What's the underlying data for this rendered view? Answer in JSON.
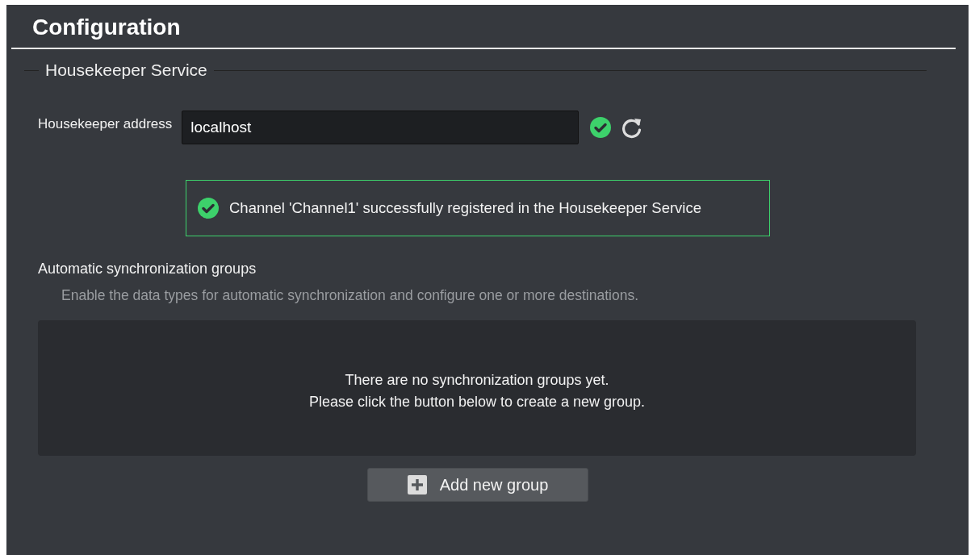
{
  "header": {
    "title": "Configuration"
  },
  "section": {
    "legend": "Housekeeper Service"
  },
  "address": {
    "label": "Housekeeper address",
    "value": "localhost",
    "valid": true
  },
  "status_message": {
    "kind": "success",
    "text": "Channel 'Channel1' successfully registered in the Housekeeper Service"
  },
  "sync_groups": {
    "title": "Automatic synchronization groups",
    "description": "Enable the data types for automatic synchronization and configure one or more destinations.",
    "empty_lines": [
      "There are no synchronization groups yet.",
      "Please click the button below to create a new group."
    ],
    "add_button": "Add new group"
  }
}
